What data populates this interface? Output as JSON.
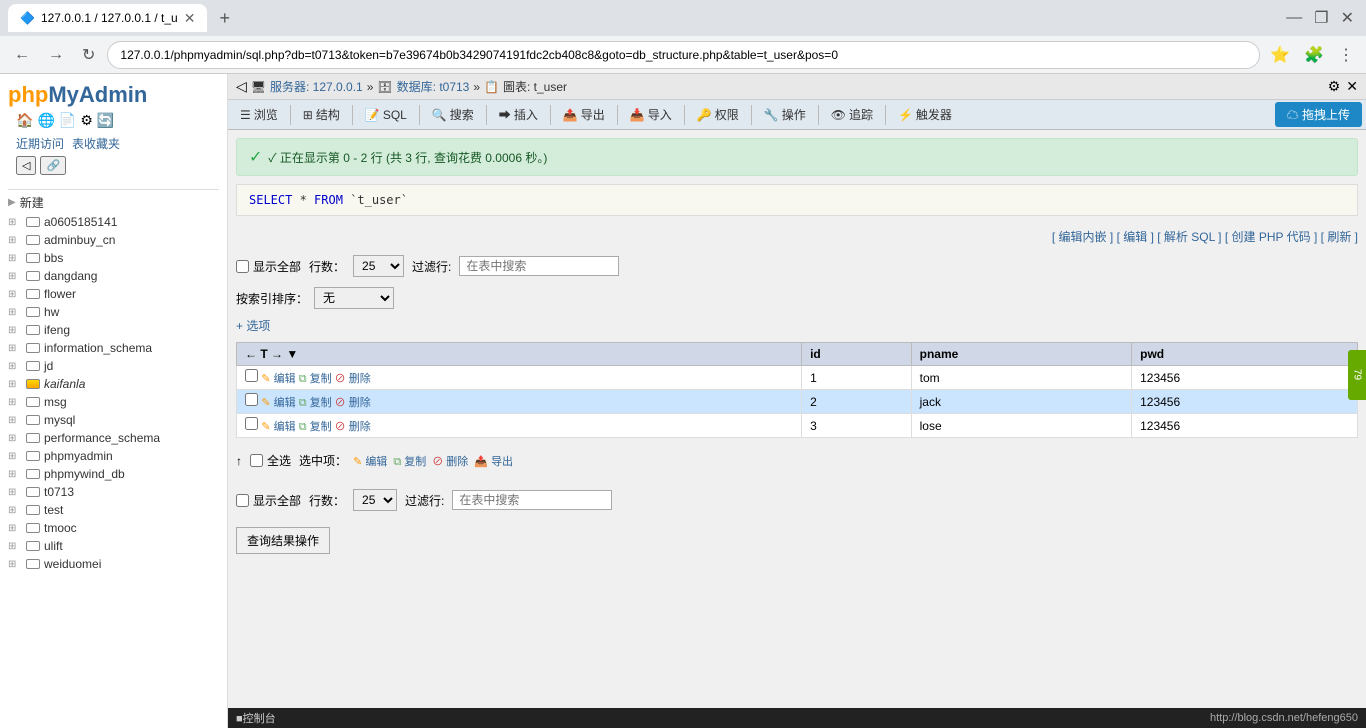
{
  "browser": {
    "tab_title": "127.0.0.1 / 127.0.0.1 / t_u",
    "url": "127.0.0.1/phpmyadmin/sql.php?db=t0713&token=b7e39674b0b3429074191fdc2cb408c8&goto=db_structure.php&table=t_user&pos=0",
    "back_btn": "←",
    "forward_btn": "→",
    "refresh_btn": "↻"
  },
  "pma": {
    "logo_php": "php",
    "logo_myadmin": "MyAdmin",
    "breadcrumb_server": "服务器: 127.0.0.1",
    "breadcrumb_sep1": "»",
    "breadcrumb_db": "数据库: t0713",
    "breadcrumb_sep2": "»",
    "breadcrumb_table": "圖表: t_user",
    "toolbar": {
      "browse": "浏览",
      "structure": "结构",
      "sql": "SQL",
      "search": "搜索",
      "insert": "插入",
      "export": "导出",
      "import": "导入",
      "permissions": "权限",
      "operations": "操作",
      "track": "追踪",
      "triggers": "触发器",
      "upload": "拖拽上传"
    }
  },
  "sidebar": {
    "recent": "近期访问",
    "favorites": "表收藏夹",
    "databases": [
      {
        "name": "新建",
        "type": "new"
      },
      {
        "name": "a0605185141",
        "type": "db"
      },
      {
        "name": "adminbuy_cn",
        "type": "db"
      },
      {
        "name": "bbs",
        "type": "db"
      },
      {
        "name": "dangdang",
        "type": "db"
      },
      {
        "name": "flower",
        "type": "db"
      },
      {
        "name": "hw",
        "type": "db"
      },
      {
        "name": "ifeng",
        "type": "db"
      },
      {
        "name": "information_schema",
        "type": "db"
      },
      {
        "name": "jd",
        "type": "db"
      },
      {
        "name": "kaifanla",
        "type": "db_special"
      },
      {
        "name": "msg",
        "type": "db"
      },
      {
        "name": "mysql",
        "type": "db"
      },
      {
        "name": "performance_schema",
        "type": "db"
      },
      {
        "name": "phpmyadmin",
        "type": "db"
      },
      {
        "name": "phpmywind_db",
        "type": "db"
      },
      {
        "name": "t0713",
        "type": "db"
      },
      {
        "name": "test",
        "type": "db"
      },
      {
        "name": "tmooc",
        "type": "db"
      },
      {
        "name": "ulift",
        "type": "db"
      },
      {
        "name": "weiduomei",
        "type": "db"
      }
    ]
  },
  "content": {
    "success_message": "✓ 正在显示第 0 - 2 行 (共 3 行, 查询花费 0.0006 秒。)",
    "sql_query": "SELECT * FROM `t_user`",
    "links": {
      "edit_inline": "编辑内嵌",
      "edit": "编辑",
      "parse_sql": "解析 SQL",
      "create_php": "创建 PHP 代码",
      "refresh": "刷新"
    },
    "show_all_label": "显示全部",
    "rows_label": "行数：",
    "rows_value": "25",
    "filter_label": "过滤行:",
    "filter_placeholder": "在表中搜索",
    "sort_label": "按索引排序：",
    "sort_value": "无",
    "options_label": "+ 选项",
    "table": {
      "columns": [
        "id",
        "pname",
        "pwd"
      ],
      "rows": [
        {
          "id": "1",
          "pname": "tom",
          "pwd": "123456",
          "actions": {
            "edit": "编辑",
            "copy": "复制",
            "delete": "删除"
          }
        },
        {
          "id": "2",
          "pname": "jack",
          "pwd": "123456",
          "actions": {
            "edit": "编辑",
            "copy": "复制",
            "delete": "删除"
          }
        },
        {
          "id": "3",
          "pname": "lose",
          "pwd": "123456",
          "actions": {
            "edit": "编辑",
            "copy": "复制",
            "delete": "删除"
          }
        }
      ]
    },
    "bottom": {
      "select_all": "全选",
      "selected_label": "选中项：",
      "edit": "编辑",
      "copy": "复制",
      "delete": "删除",
      "export": "导出"
    },
    "show_all_bottom": "显示全部",
    "rows_bottom": "行数：",
    "filter_bottom_placeholder": "在表中搜索",
    "query_result_btn": "查询结果操作",
    "console_label": "■控制台",
    "footer_url": "http://blog.csdn.net/hefeng650"
  }
}
